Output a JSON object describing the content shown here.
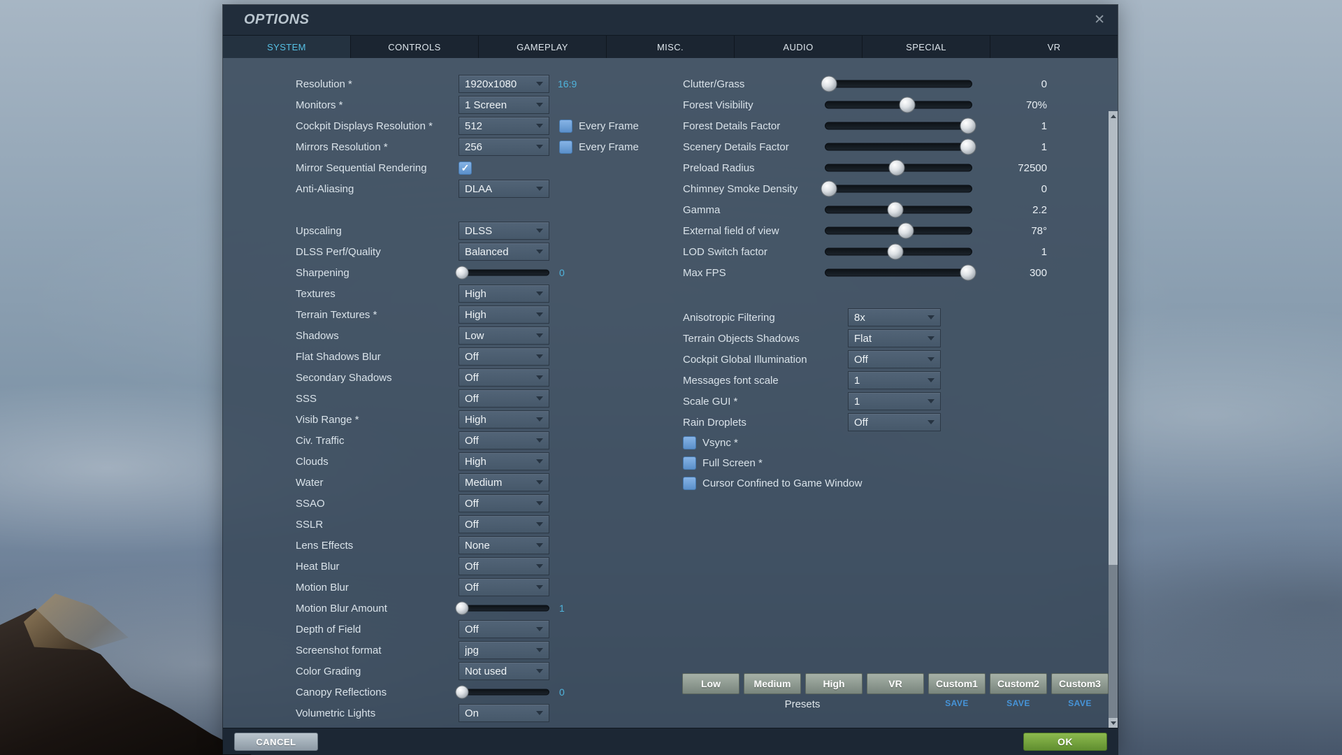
{
  "window": {
    "title": "OPTIONS",
    "close": "✕"
  },
  "tabs": [
    "SYSTEM",
    "CONTROLS",
    "GAMEPLAY",
    "MISC.",
    "AUDIO",
    "SPECIAL",
    "VR"
  ],
  "active_tab": "SYSTEM",
  "left": {
    "rows": [
      {
        "label": "Resolution *",
        "type": "dropdown",
        "value": "1920x1080",
        "suffix": "16:9"
      },
      {
        "label": "Monitors *",
        "type": "dropdown",
        "value": "1 Screen"
      },
      {
        "label": "Cockpit Displays Resolution *",
        "type": "dropdown",
        "value": "512",
        "extra_checkbox": {
          "label": "Every Frame",
          "checked": false
        }
      },
      {
        "label": "Mirrors Resolution *",
        "type": "dropdown",
        "value": "256",
        "extra_checkbox": {
          "label": "Every Frame",
          "checked": false
        }
      },
      {
        "label": "Mirror Sequential Rendering",
        "type": "checkbox",
        "checked": true
      },
      {
        "label": "Anti-Aliasing",
        "type": "dropdown",
        "value": "DLAA",
        "gap_after": true
      },
      {
        "label": "Upscaling",
        "type": "dropdown",
        "value": "DLSS"
      },
      {
        "label": "DLSS Perf/Quality",
        "type": "dropdown",
        "value": "Balanced"
      },
      {
        "label": "Sharpening",
        "type": "slider",
        "value": "0",
        "pct": 4
      },
      {
        "label": "Textures",
        "type": "dropdown",
        "value": "High"
      },
      {
        "label": "Terrain Textures *",
        "type": "dropdown",
        "value": "High"
      },
      {
        "label": "Shadows",
        "type": "dropdown",
        "value": "Low"
      },
      {
        "label": "Flat Shadows Blur",
        "type": "dropdown",
        "value": "Off"
      },
      {
        "label": "Secondary Shadows",
        "type": "dropdown",
        "value": "Off"
      },
      {
        "label": "SSS",
        "type": "dropdown",
        "value": "Off"
      },
      {
        "label": "Visib Range *",
        "type": "dropdown",
        "value": "High"
      },
      {
        "label": "Civ. Traffic",
        "type": "dropdown",
        "value": "Off"
      },
      {
        "label": "Clouds",
        "type": "dropdown",
        "value": "High"
      },
      {
        "label": "Water",
        "type": "dropdown",
        "value": "Medium"
      },
      {
        "label": "SSAO",
        "type": "dropdown",
        "value": "Off"
      },
      {
        "label": "SSLR",
        "type": "dropdown",
        "value": "Off"
      },
      {
        "label": "Lens Effects",
        "type": "dropdown",
        "value": "None"
      },
      {
        "label": "Heat Blur",
        "type": "dropdown",
        "value": "Off"
      },
      {
        "label": "Motion Blur",
        "type": "dropdown",
        "value": "Off"
      },
      {
        "label": "Motion Blur Amount",
        "type": "slider",
        "value": "1",
        "pct": 4
      },
      {
        "label": "Depth of Field",
        "type": "dropdown",
        "value": "Off"
      },
      {
        "label": "Screenshot format",
        "type": "dropdown",
        "value": "jpg"
      },
      {
        "label": "Color Grading",
        "type": "dropdown",
        "value": "Not used"
      },
      {
        "label": "Canopy Reflections",
        "type": "slider",
        "value": "0",
        "pct": 4
      },
      {
        "label": "Volumetric Lights",
        "type": "dropdown",
        "value": "On"
      }
    ]
  },
  "right": {
    "sliders": [
      {
        "label": "Clutter/Grass",
        "value": "0",
        "pct": 3
      },
      {
        "label": "Forest Visibility",
        "value": "70%",
        "pct": 56
      },
      {
        "label": "Forest Details Factor",
        "value": "1",
        "pct": 97
      },
      {
        "label": "Scenery Details Factor",
        "value": "1",
        "pct": 97
      },
      {
        "label": "Preload Radius",
        "value": "72500",
        "pct": 49
      },
      {
        "label": "Chimney Smoke Density",
        "value": "0",
        "pct": 3
      },
      {
        "label": "Gamma",
        "value": "2.2",
        "pct": 48
      },
      {
        "label": "External field of view",
        "value": "78°",
        "pct": 55
      },
      {
        "label": "LOD Switch factor",
        "value": "1",
        "pct": 48
      },
      {
        "label": "Max FPS",
        "value": "300",
        "pct": 97
      }
    ],
    "dropdowns": [
      {
        "label": "Anisotropic Filtering",
        "value": "8x"
      },
      {
        "label": "Terrain Objects Shadows",
        "value": "Flat"
      },
      {
        "label": "Cockpit Global Illumination",
        "value": "Off"
      },
      {
        "label": "Messages font scale",
        "value": "1"
      },
      {
        "label": "Scale GUI *",
        "value": "1"
      },
      {
        "label": "Rain Droplets",
        "value": "Off"
      }
    ],
    "checkboxes": [
      {
        "label": "Vsync *",
        "checked": false
      },
      {
        "label": "Full Screen *",
        "checked": false
      },
      {
        "label": "Cursor Confined to Game Window",
        "checked": false
      }
    ]
  },
  "presets": {
    "buttons": [
      "Low",
      "Medium",
      "High",
      "VR",
      "Custom1",
      "Custom2",
      "Custom3"
    ],
    "caption": "Presets",
    "save": "SAVE",
    "save_under": [
      "Custom1",
      "Custom2",
      "Custom3"
    ]
  },
  "footer": {
    "cancel": "CANCEL",
    "ok": "OK"
  },
  "colors": {
    "accent_cyan": "#4fb4dc",
    "active_tab_text": "#56c0e4",
    "checkbox_blue": "#6ea3dd",
    "save_blue": "#4694d8",
    "ok_green": "#75a43f",
    "check_mark": "✓"
  }
}
